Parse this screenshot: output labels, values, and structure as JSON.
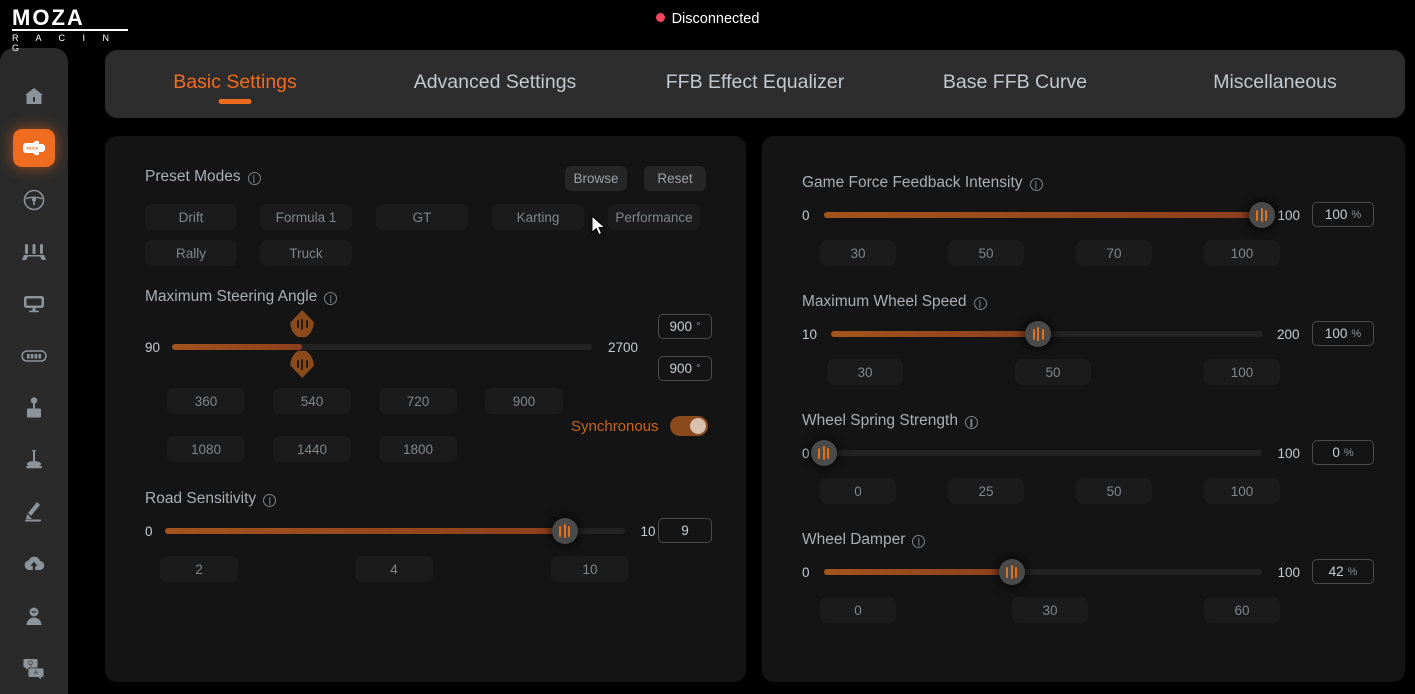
{
  "app": {
    "logo_main": "MOZA",
    "logo_sub": "R A C I N G",
    "status_text": "Disconnected",
    "status_color": "#f4455f",
    "accent_color": "#ef6c1f"
  },
  "sidebar": {
    "items": [
      {
        "icon": "home-icon",
        "name": "sidebar-item-home",
        "active": false
      },
      {
        "icon": "wheel-base-icon",
        "name": "sidebar-item-wheel-base",
        "active": true
      },
      {
        "icon": "steering-wheel-icon",
        "name": "sidebar-item-steering-wheel",
        "active": false
      },
      {
        "icon": "pedals-icon",
        "name": "sidebar-item-pedals",
        "active": false
      },
      {
        "icon": "display-icon",
        "name": "sidebar-item-display",
        "active": false
      },
      {
        "icon": "shifter-strip-icon",
        "name": "sidebar-item-dash",
        "active": false
      },
      {
        "icon": "shifter-icon",
        "name": "sidebar-item-shifter",
        "active": false
      },
      {
        "icon": "handbrake-icon",
        "name": "sidebar-item-handbrake",
        "active": false
      },
      {
        "icon": "sequential-shifter-icon",
        "name": "sidebar-item-sequential-shifter",
        "active": false
      },
      {
        "icon": "cloud-upload-icon",
        "name": "sidebar-item-cloud",
        "active": false
      },
      {
        "icon": "user-icon",
        "name": "sidebar-item-account",
        "active": false
      },
      {
        "icon": "qa-icon",
        "name": "sidebar-item-support",
        "active": false
      }
    ]
  },
  "tabs": [
    {
      "label": "Basic Settings",
      "active": true
    },
    {
      "label": "Advanced Settings",
      "active": false
    },
    {
      "label": "FFB Effect Equalizer",
      "active": false
    },
    {
      "label": "Base FFB Curve",
      "active": false
    },
    {
      "label": "Miscellaneous",
      "active": false
    }
  ],
  "left_panel": {
    "preset_modes": {
      "title": "Preset Modes",
      "browse_label": "Browse",
      "reset_label": "Reset",
      "modes": [
        "Drift",
        "Formula 1",
        "GT",
        "Karting",
        "Performance",
        "Rally",
        "Truck"
      ]
    },
    "max_steering_angle": {
      "title": "Maximum Steering Angle",
      "min": "90",
      "max": "2700",
      "min_value": 90,
      "max_value": 2700,
      "value": 900,
      "value_top": "900",
      "value_bottom": "900",
      "unit": "°",
      "presets": [
        "360",
        "540",
        "720",
        "900",
        "1080",
        "1440",
        "1800"
      ],
      "sync_label": "Synchronous",
      "sync_on": true
    },
    "road_sensitivity": {
      "title": "Road Sensitivity",
      "min": "0",
      "max": "10",
      "min_value": 0,
      "max_value": 10,
      "value": 9,
      "value_text": "9",
      "presets": [
        "2",
        "4",
        "10"
      ]
    }
  },
  "right_panel": {
    "game_ffb_intensity": {
      "title": "Game Force Feedback Intensity",
      "min": "0",
      "max": "100",
      "min_value": 0,
      "max_value": 100,
      "value": 100,
      "value_text": "100",
      "unit": "%",
      "presets": [
        "30",
        "50",
        "70",
        "100"
      ]
    },
    "max_wheel_speed": {
      "title": "Maximum Wheel Speed",
      "min": "10",
      "max": "200",
      "min_value": 10,
      "max_value": 200,
      "value": 100,
      "value_text": "100",
      "unit": "%",
      "presets": [
        "30",
        "50",
        "100"
      ]
    },
    "wheel_spring_strength": {
      "title": "Wheel Spring Strength",
      "min": "0",
      "max": "100",
      "min_value": 0,
      "max_value": 100,
      "value": 0,
      "value_text": "0",
      "unit": "%",
      "presets": [
        "0",
        "25",
        "50",
        "100"
      ]
    },
    "wheel_damper": {
      "title": "Wheel Damper",
      "min": "0",
      "max": "100",
      "min_value": 0,
      "max_value": 100,
      "value": 42,
      "value_text": "42",
      "unit": "%",
      "presets": [
        "0",
        "30",
        "60"
      ]
    }
  }
}
